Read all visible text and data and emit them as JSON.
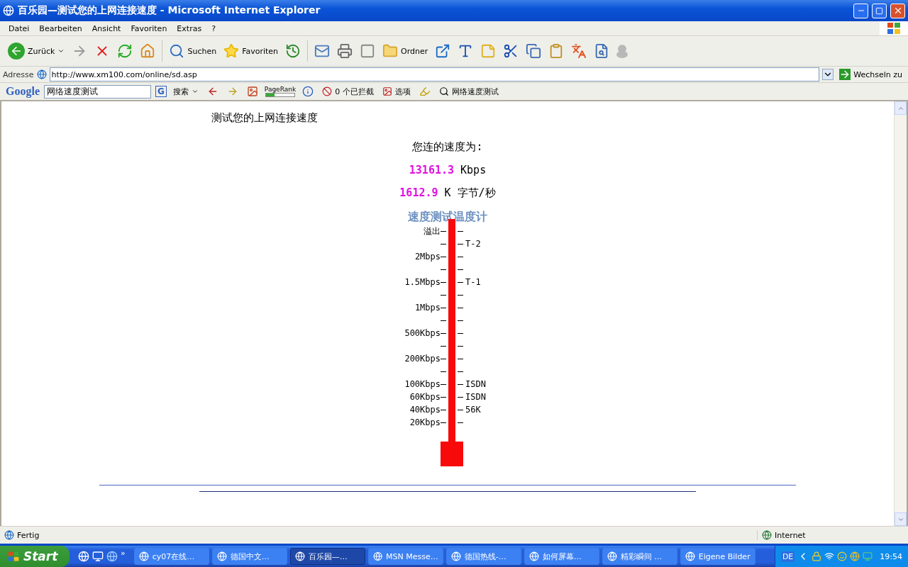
{
  "window": {
    "title": "百乐园—测试您的上网连接速度",
    "app_name": " - Microsoft Internet Explorer"
  },
  "menu": [
    "Datei",
    "Bearbeiten",
    "Ansicht",
    "Favoriten",
    "Extras",
    "?"
  ],
  "toolbar": {
    "back": "Zurück",
    "search": "Suchen",
    "favorites": "Favoriten",
    "folders": "Ordner"
  },
  "address": {
    "label": "Adresse",
    "url": "http://www.xm100.com/online/sd.asp",
    "go": "Wechseln zu"
  },
  "google_bar": {
    "logo": "Google",
    "search_logo": "G",
    "query": "网络速度测试",
    "search": "搜索",
    "pagerank": {
      "label": "PageRank",
      "level": 0.3
    },
    "blocked": "0 个已拦截",
    "options": "选项",
    "highlight": "网络速度测试"
  },
  "page": {
    "heading": "测试您的上网连接速度",
    "intro": "您连的速度为:",
    "speed_kbps": {
      "value": "13161.3",
      "unit": "Kbps"
    },
    "speed_bytes": {
      "value": "1612.9",
      "unit": "K 字节/秒"
    },
    "meter_title": "速度测试温度计",
    "thermometer": {
      "level": 1,
      "ticks": [
        {
          "kind": "labeled",
          "left": "溢出"
        },
        {
          "kind": "labeled",
          "right": "T-2"
        },
        {
          "kind": "labeled",
          "left": "2Mbps"
        },
        {
          "kind": "blank"
        },
        {
          "kind": "labeled",
          "left": "1.5Mbps",
          "right": "T-1"
        },
        {
          "kind": "blank"
        },
        {
          "kind": "labeled",
          "left": "1Mbps"
        },
        {
          "kind": "blank"
        },
        {
          "kind": "labeled",
          "left": "500Kbps"
        },
        {
          "kind": "blank"
        },
        {
          "kind": "labeled",
          "left": "200Kbps"
        },
        {
          "kind": "blank"
        },
        {
          "kind": "labeled",
          "left": "100Kbps",
          "right": "ISDN"
        },
        {
          "kind": "labeled",
          "left": "60Kbps",
          "right": "ISDN"
        },
        {
          "kind": "labeled",
          "left": "40Kbps",
          "right": "56K"
        },
        {
          "kind": "labeled",
          "left": "20Kbps"
        }
      ]
    }
  },
  "status_bar": {
    "status": "Fertig",
    "zone": "Internet"
  },
  "taskbar": {
    "start": "Start",
    "more": "»",
    "items": [
      {
        "label": "cy07在线…",
        "selected": false
      },
      {
        "label": "德国中文…",
        "selected": false
      },
      {
        "label": "百乐园—…",
        "selected": true
      },
      {
        "label": "MSN Messe…",
        "selected": false
      },
      {
        "label": "德国热线-…",
        "selected": false
      },
      {
        "label": "如何屏幕…",
        "selected": false
      },
      {
        "label": "精彩瞬间 …",
        "selected": false
      },
      {
        "label": "Eigene Bilder",
        "selected": false
      }
    ],
    "language": "DE",
    "clock": "19:54"
  }
}
